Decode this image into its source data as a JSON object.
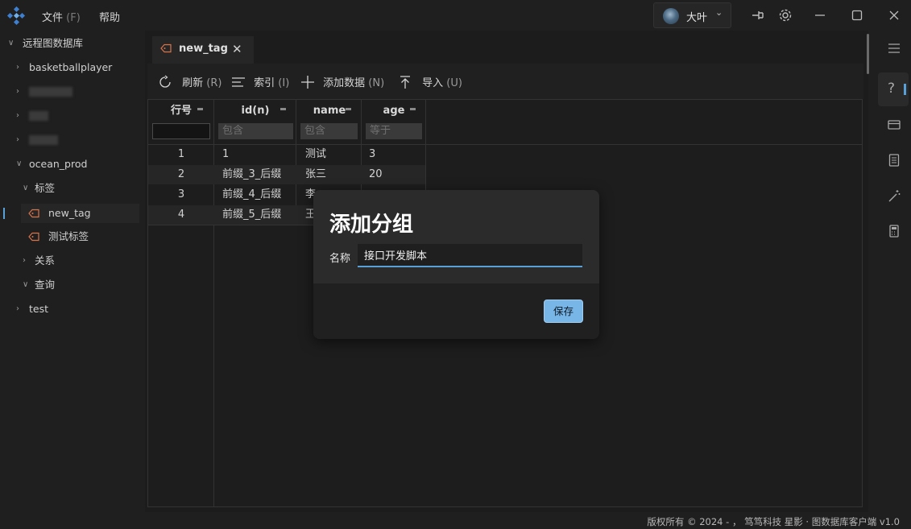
{
  "menubar": {
    "file_label": "文件",
    "file_accel": "(F)",
    "help_label": "帮助"
  },
  "user": {
    "name": "大叶"
  },
  "sidebar": {
    "root_label": "远程图数据库",
    "items": [
      {
        "label": "basketballplayer"
      },
      {
        "label": ""
      },
      {
        "label": ""
      },
      {
        "label": ""
      },
      {
        "label": "ocean_prod"
      },
      {
        "label": "标签"
      },
      {
        "label": "new_tag"
      },
      {
        "label": "测试标签"
      },
      {
        "label": "关系"
      },
      {
        "label": "查询"
      },
      {
        "label": "test"
      }
    ]
  },
  "tab": {
    "label": "new_tag"
  },
  "toolbar": {
    "refresh_label": "刷新",
    "refresh_accel": "(R)",
    "index_label": "索引",
    "index_accel": "(I)",
    "add_label": "添加数据",
    "add_accel": "(N)",
    "import_label": "导入",
    "import_accel": "(U)"
  },
  "table": {
    "columns": [
      "行号",
      "id(n)",
      "name",
      "age"
    ],
    "filters": [
      "",
      "包含",
      "包含",
      "等于"
    ],
    "rows": [
      {
        "num": "1",
        "id": "1",
        "name": "测试",
        "age": "3"
      },
      {
        "num": "2",
        "id": "前缀_3_后缀",
        "name": "张三",
        "age": "20"
      },
      {
        "num": "3",
        "id": "前缀_4_后缀",
        "name": "李",
        "age": ""
      },
      {
        "num": "4",
        "id": "前缀_5_后缀",
        "name": "王",
        "age": ""
      }
    ]
  },
  "modal": {
    "title": "添加分组",
    "name_label": "名称",
    "name_value": "接口开发脚本",
    "save_label": "保存"
  },
  "status": {
    "text": "版权所有 © 2024 - ， 笃笃科技 星影 · 图数据库客户端 v1.0"
  },
  "colors": {
    "accent": "#5aa0d8",
    "save_button": "#78b6e8",
    "tag_icon": "#d9734a"
  }
}
